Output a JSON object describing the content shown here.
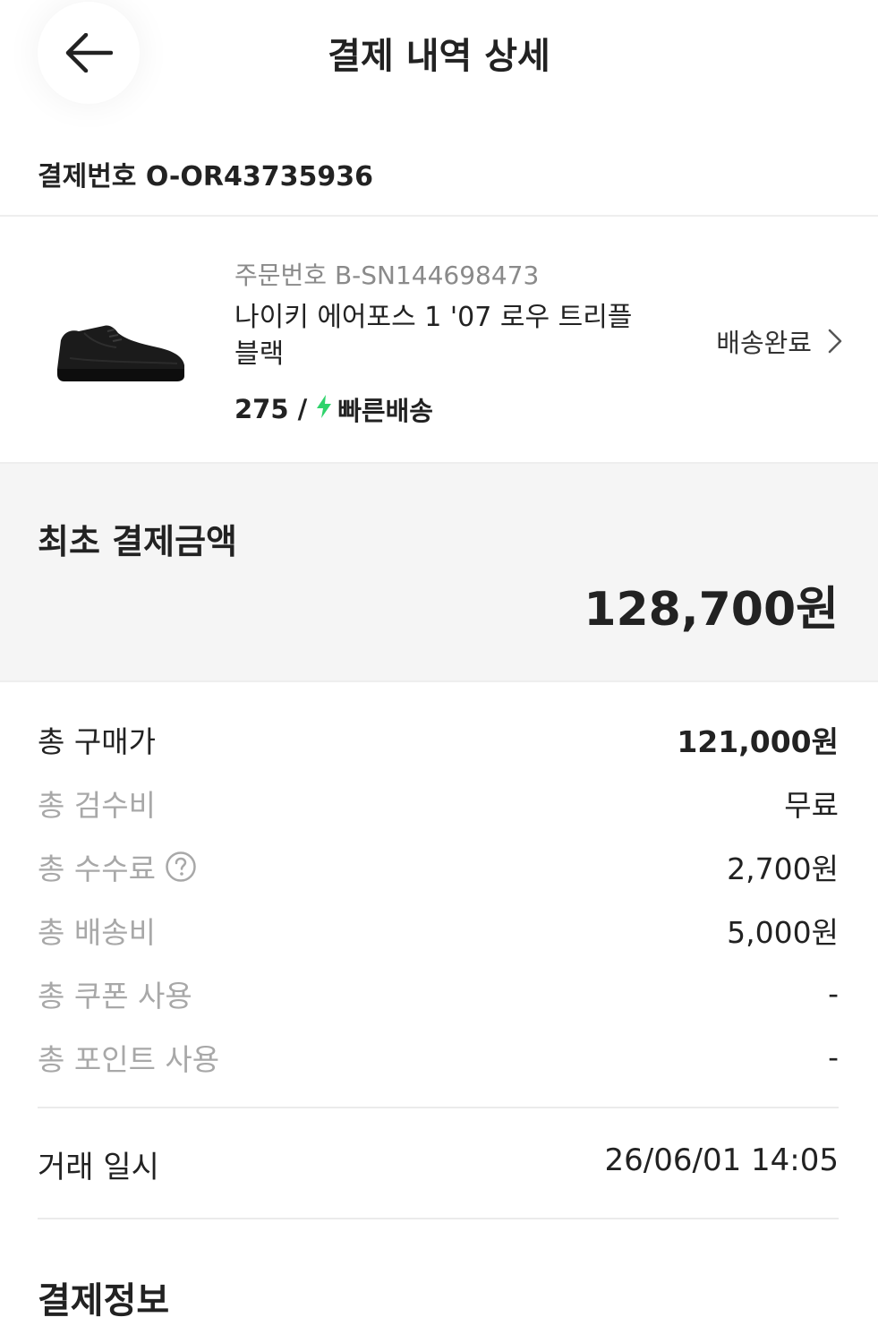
{
  "header": {
    "title": "결제 내역 상세"
  },
  "payment": {
    "number_text": "결제번호 O-OR43735936"
  },
  "order": {
    "number_text": "주문번호 B-SN144698473",
    "product_name": "나이키 에어포스 1 '07 로우 트리플 블랙",
    "size": "275 /",
    "delivery_type": "빠른배송",
    "status": "배송완료",
    "image_icon": "sneaker-image",
    "accent_color": "#2fd36b"
  },
  "summary": {
    "title": "최초 결제금액",
    "amount": "128,700원"
  },
  "breakdown": [
    {
      "label": "총 구매가",
      "value": "121,000원"
    },
    {
      "label": "총 검수비",
      "value": "무료"
    },
    {
      "label": "총 수수료",
      "value": "2,700원"
    },
    {
      "label": "총 배송비",
      "value": "5,000원"
    },
    {
      "label": "총 쿠폰 사용",
      "value": "-"
    },
    {
      "label": "총 포인트 사용",
      "value": "-"
    }
  ],
  "trade": {
    "label": "거래 일시",
    "value": "26/06/01 14:05"
  },
  "payment_info": {
    "title": "결제정보"
  }
}
